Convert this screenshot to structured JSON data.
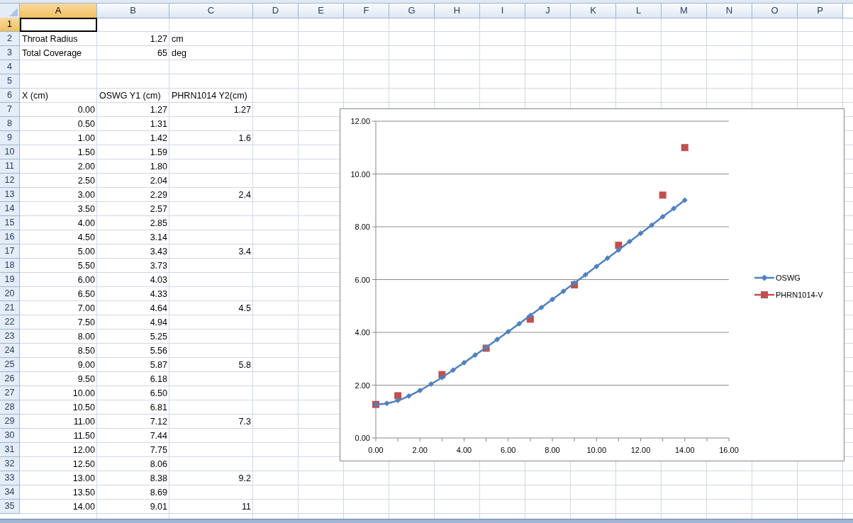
{
  "columns": [
    {
      "label": "A",
      "selected": true
    },
    {
      "label": "B",
      "selected": false
    },
    {
      "label": "C",
      "selected": false
    },
    {
      "label": "D",
      "selected": false
    },
    {
      "label": "E",
      "selected": false
    },
    {
      "label": "F",
      "selected": false
    },
    {
      "label": "G",
      "selected": false
    },
    {
      "label": "H",
      "selected": false
    },
    {
      "label": "I",
      "selected": false
    },
    {
      "label": "J",
      "selected": false
    },
    {
      "label": "K",
      "selected": false
    },
    {
      "label": "L",
      "selected": false
    },
    {
      "label": "M",
      "selected": false
    },
    {
      "label": "N",
      "selected": false
    },
    {
      "label": "O",
      "selected": false
    },
    {
      "label": "P",
      "selected": false
    }
  ],
  "rows": [
    {
      "num": "1",
      "selected": true
    },
    {
      "num": "2",
      "selected": false,
      "a": {
        "text": "Throat Radius",
        "kind": "text"
      },
      "b": {
        "text": "1.27",
        "kind": "number"
      },
      "c": {
        "text": "cm",
        "kind": "text"
      }
    },
    {
      "num": "3",
      "selected": false,
      "a": {
        "text": "Total Coverage",
        "kind": "text"
      },
      "b": {
        "text": "65",
        "kind": "number"
      },
      "c": {
        "text": "deg",
        "kind": "text"
      }
    },
    {
      "num": "4",
      "selected": false
    },
    {
      "num": "5",
      "selected": false
    },
    {
      "num": "6",
      "selected": false,
      "a": {
        "text": "X (cm)",
        "kind": "text"
      },
      "b": {
        "text": "OSWG Y1 (cm)",
        "kind": "text"
      },
      "c": {
        "text": "PHRN1014 Y2(cm)",
        "kind": "text"
      }
    },
    {
      "num": "7",
      "selected": false,
      "a": {
        "text": "0.00",
        "kind": "number"
      },
      "b": {
        "text": "1.27",
        "kind": "number"
      },
      "c": {
        "text": "1.27",
        "kind": "number"
      }
    },
    {
      "num": "8",
      "selected": false,
      "a": {
        "text": "0.50",
        "kind": "number"
      },
      "b": {
        "text": "1.31",
        "kind": "number"
      }
    },
    {
      "num": "9",
      "selected": false,
      "a": {
        "text": "1.00",
        "kind": "number"
      },
      "b": {
        "text": "1.42",
        "kind": "number"
      },
      "c": {
        "text": "1.6",
        "kind": "number"
      }
    },
    {
      "num": "10",
      "selected": false,
      "a": {
        "text": "1.50",
        "kind": "number"
      },
      "b": {
        "text": "1.59",
        "kind": "number"
      }
    },
    {
      "num": "11",
      "selected": false,
      "a": {
        "text": "2.00",
        "kind": "number"
      },
      "b": {
        "text": "1.80",
        "kind": "number"
      }
    },
    {
      "num": "12",
      "selected": false,
      "a": {
        "text": "2.50",
        "kind": "number"
      },
      "b": {
        "text": "2.04",
        "kind": "number"
      }
    },
    {
      "num": "13",
      "selected": false,
      "a": {
        "text": "3.00",
        "kind": "number"
      },
      "b": {
        "text": "2.29",
        "kind": "number"
      },
      "c": {
        "text": "2.4",
        "kind": "number"
      }
    },
    {
      "num": "14",
      "selected": false,
      "a": {
        "text": "3.50",
        "kind": "number"
      },
      "b": {
        "text": "2.57",
        "kind": "number"
      }
    },
    {
      "num": "15",
      "selected": false,
      "a": {
        "text": "4.00",
        "kind": "number"
      },
      "b": {
        "text": "2.85",
        "kind": "number"
      }
    },
    {
      "num": "16",
      "selected": false,
      "a": {
        "text": "4.50",
        "kind": "number"
      },
      "b": {
        "text": "3.14",
        "kind": "number"
      }
    },
    {
      "num": "17",
      "selected": false,
      "a": {
        "text": "5.00",
        "kind": "number"
      },
      "b": {
        "text": "3.43",
        "kind": "number"
      },
      "c": {
        "text": "3.4",
        "kind": "number"
      }
    },
    {
      "num": "18",
      "selected": false,
      "a": {
        "text": "5.50",
        "kind": "number"
      },
      "b": {
        "text": "3.73",
        "kind": "number"
      }
    },
    {
      "num": "19",
      "selected": false,
      "a": {
        "text": "6.00",
        "kind": "number"
      },
      "b": {
        "text": "4.03",
        "kind": "number"
      }
    },
    {
      "num": "20",
      "selected": false,
      "a": {
        "text": "6.50",
        "kind": "number"
      },
      "b": {
        "text": "4.33",
        "kind": "number"
      }
    },
    {
      "num": "21",
      "selected": false,
      "a": {
        "text": "7.00",
        "kind": "number"
      },
      "b": {
        "text": "4.64",
        "kind": "number"
      },
      "c": {
        "text": "4.5",
        "kind": "number"
      }
    },
    {
      "num": "22",
      "selected": false,
      "a": {
        "text": "7.50",
        "kind": "number"
      },
      "b": {
        "text": "4.94",
        "kind": "number"
      }
    },
    {
      "num": "23",
      "selected": false,
      "a": {
        "text": "8.00",
        "kind": "number"
      },
      "b": {
        "text": "5.25",
        "kind": "number"
      }
    },
    {
      "num": "24",
      "selected": false,
      "a": {
        "text": "8.50",
        "kind": "number"
      },
      "b": {
        "text": "5.56",
        "kind": "number"
      }
    },
    {
      "num": "25",
      "selected": false,
      "a": {
        "text": "9.00",
        "kind": "number"
      },
      "b": {
        "text": "5.87",
        "kind": "number"
      },
      "c": {
        "text": "5.8",
        "kind": "number"
      }
    },
    {
      "num": "26",
      "selected": false,
      "a": {
        "text": "9.50",
        "kind": "number"
      },
      "b": {
        "text": "6.18",
        "kind": "number"
      }
    },
    {
      "num": "27",
      "selected": false,
      "a": {
        "text": "10.00",
        "kind": "number"
      },
      "b": {
        "text": "6.50",
        "kind": "number"
      }
    },
    {
      "num": "28",
      "selected": false,
      "a": {
        "text": "10.50",
        "kind": "number"
      },
      "b": {
        "text": "6.81",
        "kind": "number"
      }
    },
    {
      "num": "29",
      "selected": false,
      "a": {
        "text": "11.00",
        "kind": "number"
      },
      "b": {
        "text": "7.12",
        "kind": "number"
      },
      "c": {
        "text": "7.3",
        "kind": "number"
      }
    },
    {
      "num": "30",
      "selected": false,
      "a": {
        "text": "11.50",
        "kind": "number"
      },
      "b": {
        "text": "7.44",
        "kind": "number"
      }
    },
    {
      "num": "31",
      "selected": false,
      "a": {
        "text": "12.00",
        "kind": "number"
      },
      "b": {
        "text": "7.75",
        "kind": "number"
      }
    },
    {
      "num": "32",
      "selected": false,
      "a": {
        "text": "12.50",
        "kind": "number"
      },
      "b": {
        "text": "8.06",
        "kind": "number"
      }
    },
    {
      "num": "33",
      "selected": false,
      "a": {
        "text": "13.00",
        "kind": "number"
      },
      "b": {
        "text": "8.38",
        "kind": "number"
      },
      "c": {
        "text": "9.2",
        "kind": "number"
      }
    },
    {
      "num": "34",
      "selected": false,
      "a": {
        "text": "13.50",
        "kind": "number"
      },
      "b": {
        "text": "8.69",
        "kind": "number"
      }
    },
    {
      "num": "35",
      "selected": false,
      "a": {
        "text": "14.00",
        "kind": "number"
      },
      "b": {
        "text": "9.01",
        "kind": "number"
      },
      "c": {
        "text": "11",
        "kind": "number"
      }
    }
  ],
  "chart": {
    "chart_data": {
      "type": "line",
      "grid": true,
      "legend": true,
      "x": [
        0,
        0.5,
        1,
        1.5,
        2,
        2.5,
        3,
        3.5,
        4,
        4.5,
        5,
        5.5,
        6,
        6.5,
        7,
        7.5,
        8,
        8.5,
        9,
        9.5,
        10,
        10.5,
        11,
        11.5,
        12,
        12.5,
        13,
        13.5,
        14
      ],
      "series": [
        {
          "name": "OSWG",
          "color": "#4f81bd",
          "marker": "diamond",
          "values": [
            1.27,
            1.31,
            1.42,
            1.59,
            1.8,
            2.04,
            2.29,
            2.57,
            2.85,
            3.14,
            3.43,
            3.73,
            4.03,
            4.33,
            4.64,
            4.94,
            5.25,
            5.56,
            5.87,
            6.18,
            6.5,
            6.81,
            7.12,
            7.44,
            7.75,
            8.06,
            8.38,
            8.69,
            9.01
          ]
        },
        {
          "name": "PHRN1014-V",
          "color": "#c0504d",
          "marker": "square",
          "type": "scatter",
          "values": [
            1.27,
            null,
            1.6,
            null,
            null,
            null,
            2.4,
            null,
            null,
            null,
            3.4,
            null,
            null,
            null,
            4.5,
            null,
            null,
            null,
            5.8,
            null,
            null,
            null,
            7.3,
            null,
            null,
            null,
            9.2,
            null,
            11
          ]
        }
      ],
      "xlim": [
        0,
        16
      ],
      "ylim": [
        0,
        12
      ],
      "xticks": [
        {
          "value": 0,
          "label": "0.00"
        },
        {
          "value": 2,
          "label": "2.00"
        },
        {
          "value": 4,
          "label": "4.00"
        },
        {
          "value": 6,
          "label": "6.00"
        },
        {
          "value": 8,
          "label": "8.00"
        },
        {
          "value": 10,
          "label": "10.00"
        },
        {
          "value": 12,
          "label": "12.00"
        },
        {
          "value": 14,
          "label": "14.00"
        },
        {
          "value": 16,
          "label": "16.00"
        }
      ],
      "yticks": [
        {
          "value": 0,
          "label": "0.00"
        },
        {
          "value": 2,
          "label": "2.00"
        },
        {
          "value": 4,
          "label": "4.00"
        },
        {
          "value": 6,
          "label": "6.00"
        },
        {
          "value": 8,
          "label": "8.00"
        },
        {
          "value": 10,
          "label": "10.00"
        },
        {
          "value": 12,
          "label": "12.00"
        }
      ]
    }
  }
}
